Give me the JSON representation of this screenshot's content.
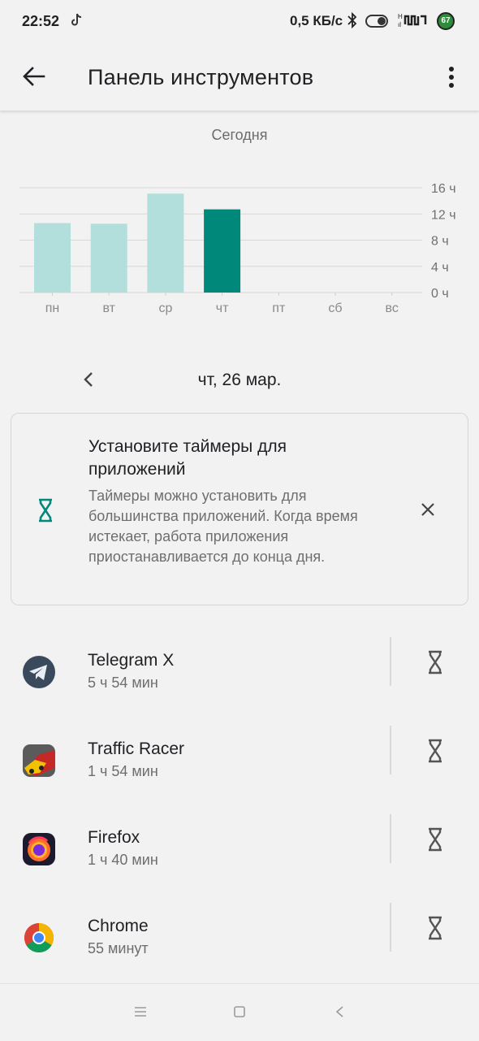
{
  "status_bar": {
    "time": "22:52",
    "speed": "0,5 КБ/с",
    "battery": "67",
    "icons": [
      "tiktok-icon",
      "bluetooth-icon",
      "toggle-icon",
      "network-icon",
      "battery-icon"
    ]
  },
  "toolbar": {
    "title": "Панель инструментов",
    "back_icon": "arrow-left-icon",
    "menu_icon": "more-vert-icon"
  },
  "period_label": "Сегодня",
  "chart_data": {
    "type": "bar",
    "categories": [
      "пн",
      "вт",
      "ср",
      "чт",
      "пт",
      "сб",
      "вс"
    ],
    "values": [
      10.6,
      10.5,
      15.1,
      12.7,
      0,
      0,
      0
    ],
    "highlighted_index": 3,
    "y_ticks": [
      "0 ч",
      "4 ч",
      "8 ч",
      "12 ч",
      "16 ч"
    ],
    "ylim": [
      0,
      16
    ],
    "bar_color": "#b2dfdb",
    "highlight_color": "#00897b",
    "grid": true
  },
  "date_nav": {
    "label": "чт, 26 мар.",
    "prev_icon": "chevron-left-icon"
  },
  "timer_card": {
    "heading": "Установите таймеры для приложений",
    "body": "Таймеры можно установить для большинства приложений. Когда время истекает, работа приложения приостанавливается до конца дня.",
    "icon": "hourglass-icon",
    "close_icon": "close-icon",
    "accent": "#00897b"
  },
  "apps": [
    {
      "name": "Telegram X",
      "usage": "5 ч 54 мин",
      "icon": "telegram-icon"
    },
    {
      "name": "Traffic Racer",
      "usage": "1 ч 54 мин",
      "icon": "traffic-racer-icon"
    },
    {
      "name": "Firefox",
      "usage": "1 ч 40 мин",
      "icon": "firefox-icon"
    },
    {
      "name": "Chrome",
      "usage": "55 минут",
      "icon": "chrome-icon"
    }
  ],
  "navbar": {
    "icons": [
      "menu-icon",
      "home-square-icon",
      "back-triangle-icon"
    ]
  }
}
